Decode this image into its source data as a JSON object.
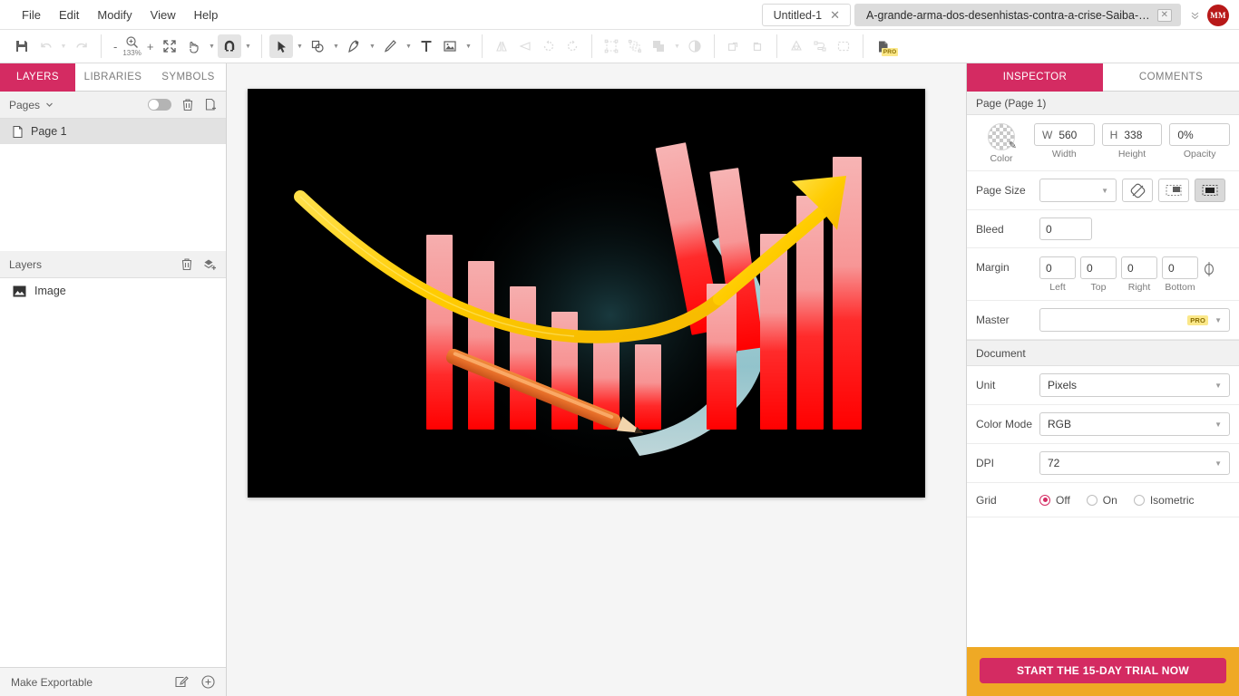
{
  "menu": {
    "items": [
      {
        "label": "File"
      },
      {
        "label": "Edit"
      },
      {
        "label": "Modify"
      },
      {
        "label": "View"
      },
      {
        "label": "Help"
      }
    ]
  },
  "tabs": {
    "items": [
      {
        "label": "Untitled-1",
        "active": false
      },
      {
        "label": "A-grande-arma-dos-desenhistas-contra-a-crise-Saiba-como-usá-la",
        "active": true
      }
    ],
    "overflow_icon": "chevron-double-down-icon",
    "close_icon": "close-icon"
  },
  "account": {
    "initials": "MM",
    "avatar_color": "#b81919"
  },
  "toolbar": {
    "save_icon": "save-icon",
    "undo_icon": "undo-icon",
    "redo_icon": "redo-icon",
    "zoom_out_label": "-",
    "zoom_in_label": "+",
    "zoom_icon": "zoom-icon",
    "zoom_level": "133%",
    "fit_icon": "fit-to-screen-icon",
    "hand_icon": "hand-tool-icon",
    "snap_icon": "magnet-snap-icon",
    "select_icon": "select-arrow-icon",
    "shape_icon": "shapes-icon",
    "pen_icon": "pen-tool-icon",
    "pencil_icon": "pencil-tool-icon",
    "text_icon": "text-tool-icon",
    "image_icon": "image-tool-icon",
    "flip_h_icon": "flip-horizontal-icon",
    "flip_v_icon": "flip-vertical-icon",
    "rotate_ccw_icon": "rotate-counterclockwise-icon",
    "rotate_cw_icon": "rotate-clockwise-icon",
    "group_icon": "group-icon",
    "ungroup_icon": "ungroup-icon",
    "boolean_icon": "boolean-union-icon",
    "mask_icon": "mask-icon",
    "bring_forward_icon": "bring-forward-icon",
    "send_backward_icon": "send-backward-icon",
    "recycle_icon": "recycle-icon",
    "path_icon": "path-connect-icon",
    "marquee_icon": "marquee-select-icon",
    "export_pro_icon": "export-pro-icon",
    "pro_badge": "PRO"
  },
  "left_panel": {
    "tabs": [
      {
        "label": "LAYERS",
        "active": true
      },
      {
        "label": "LIBRARIES",
        "active": false
      },
      {
        "label": "SYMBOLS",
        "active": false
      }
    ],
    "pages": {
      "title": "Pages",
      "chevron_icon": "chevron-down-icon",
      "toggle_icon": "toggle-switch-off",
      "delete_icon": "trash-icon",
      "add_icon": "add-page-icon",
      "items": [
        {
          "label": "Page 1",
          "icon": "page-icon",
          "selected": true
        }
      ]
    },
    "layers": {
      "title": "Layers",
      "delete_icon": "trash-icon",
      "add_icon": "add-layer-icon",
      "items": [
        {
          "label": "Image",
          "icon": "image-thumbnail-icon"
        }
      ]
    },
    "footer": {
      "label": "Make Exportable",
      "edit_icon": "edit-export-icon",
      "add_icon": "plus-circle-icon"
    }
  },
  "canvas": {
    "artwork_name": "declining-and-rising-bar-chart-with-pencil",
    "background_color": "#000000",
    "bar_color_top": "#f4a3a3",
    "bar_color_bottom": "#ff0000",
    "arrow_color": "#ffd21e",
    "swoosh_color": "#a9dde4",
    "pencil_color": "#e8702a"
  },
  "right_panel": {
    "tabs": [
      {
        "label": "INSPECTOR",
        "active": true
      },
      {
        "label": "COMMENTS",
        "active": false
      }
    ],
    "title": "Page (Page 1)",
    "color": {
      "label": "Color",
      "icon": "color-picker-icon"
    },
    "width": {
      "prefix": "W",
      "value": "560",
      "label": "Width"
    },
    "height": {
      "prefix": "H",
      "value": "338",
      "label": "Height"
    },
    "opacity": {
      "value": "0%",
      "label": "Opacity"
    },
    "page_size": {
      "label": "Page Size",
      "value": "",
      "rotate_icon": "rotate-page-icon",
      "landscape_icon": "landscape-orientation-icon",
      "portrait_icon": "portrait-orientation-icon"
    },
    "bleed": {
      "label": "Bleed",
      "value": "0"
    },
    "margin": {
      "label": "Margin",
      "fields": [
        {
          "value": "0",
          "sub": "Left"
        },
        {
          "value": "0",
          "sub": "Top"
        },
        {
          "value": "0",
          "sub": "Right"
        },
        {
          "value": "0",
          "sub": "Bottom"
        }
      ],
      "link_icon": "link-margins-icon"
    },
    "master": {
      "label": "Master",
      "value": "",
      "badge": "PRO"
    },
    "document": {
      "title": "Document",
      "unit": {
        "label": "Unit",
        "value": "Pixels"
      },
      "color_mode": {
        "label": "Color Mode",
        "value": "RGB"
      },
      "dpi": {
        "label": "DPI",
        "value": "72"
      },
      "grid": {
        "label": "Grid",
        "options": [
          {
            "label": "Off",
            "selected": true
          },
          {
            "label": "On",
            "selected": false
          },
          {
            "label": "Isometric",
            "selected": false
          }
        ]
      }
    },
    "promo": {
      "button_label": "START THE 15-DAY TRIAL NOW",
      "banner_color": "#efa925",
      "button_color": "#d42b62"
    }
  }
}
